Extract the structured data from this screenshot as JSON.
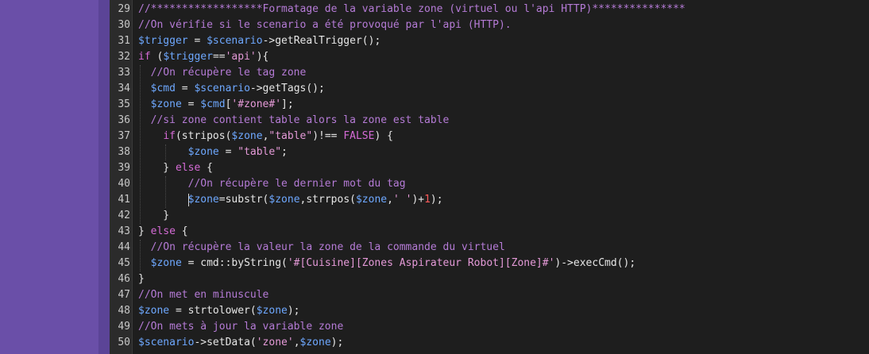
{
  "editor": {
    "lines": [
      {
        "number": "29",
        "segments": [
          {
            "t": "//******************Formatage de la variable zone (virtuel ou l'api HTTP)***************",
            "c": "c-comment"
          }
        ]
      },
      {
        "number": "30",
        "segments": [
          {
            "t": "//On vérifie si le scenario a été provoqué par l'api (HTTP).",
            "c": "c-comment"
          }
        ]
      },
      {
        "number": "31",
        "segments": [
          {
            "t": "$trigger",
            "c": "c-var"
          },
          {
            "t": " = ",
            "c": "c-op"
          },
          {
            "t": "$scenario",
            "c": "c-var"
          },
          {
            "t": "->getRealTrigger();",
            "c": "c-func"
          }
        ]
      },
      {
        "number": "32",
        "segments": [
          {
            "t": "if",
            "c": "c-kw"
          },
          {
            "t": " (",
            "c": "c-op"
          },
          {
            "t": "$trigger",
            "c": "c-var"
          },
          {
            "t": "==",
            "c": "c-op"
          },
          {
            "t": "'api'",
            "c": "c-str"
          },
          {
            "t": "){",
            "c": "c-op"
          }
        ]
      },
      {
        "number": "33",
        "segments": [
          {
            "t": "  ",
            "c": "c-op"
          },
          {
            "t": "//On récupère le tag zone",
            "c": "c-comment"
          }
        ]
      },
      {
        "number": "34",
        "segments": [
          {
            "t": "  ",
            "c": "c-op"
          },
          {
            "t": "$cmd",
            "c": "c-var"
          },
          {
            "t": " = ",
            "c": "c-op"
          },
          {
            "t": "$scenario",
            "c": "c-var"
          },
          {
            "t": "->getTags();",
            "c": "c-func"
          }
        ]
      },
      {
        "number": "35",
        "segments": [
          {
            "t": "  ",
            "c": "c-op"
          },
          {
            "t": "$zone",
            "c": "c-var"
          },
          {
            "t": " = ",
            "c": "c-op"
          },
          {
            "t": "$cmd",
            "c": "c-var"
          },
          {
            "t": "[",
            "c": "c-op"
          },
          {
            "t": "'#zone#'",
            "c": "c-str"
          },
          {
            "t": "];",
            "c": "c-op"
          }
        ]
      },
      {
        "number": "36",
        "segments": [
          {
            "t": "  ",
            "c": "c-op"
          },
          {
            "t": "//si zone contient table alors la zone est table",
            "c": "c-comment"
          }
        ]
      },
      {
        "number": "37",
        "segments": [
          {
            "t": "    ",
            "c": "c-op"
          },
          {
            "t": "if",
            "c": "c-kw"
          },
          {
            "t": "(stripos(",
            "c": "c-func"
          },
          {
            "t": "$zone",
            "c": "c-var"
          },
          {
            "t": ",",
            "c": "c-op"
          },
          {
            "t": "\"table\"",
            "c": "c-str"
          },
          {
            "t": ")!== ",
            "c": "c-op"
          },
          {
            "t": "FALSE",
            "c": "c-kw"
          },
          {
            "t": ") {",
            "c": "c-op"
          }
        ]
      },
      {
        "number": "38",
        "segments": [
          {
            "t": "        ",
            "c": "c-op"
          },
          {
            "t": "$zone",
            "c": "c-var"
          },
          {
            "t": " = ",
            "c": "c-op"
          },
          {
            "t": "\"table\"",
            "c": "c-str"
          },
          {
            "t": ";",
            "c": "c-op"
          }
        ]
      },
      {
        "number": "39",
        "segments": [
          {
            "t": "    } ",
            "c": "c-op"
          },
          {
            "t": "else",
            "c": "c-kw"
          },
          {
            "t": " {",
            "c": "c-op"
          }
        ]
      },
      {
        "number": "40",
        "segments": [
          {
            "t": "        ",
            "c": "c-op"
          },
          {
            "t": "//On récupère le dernier mot du tag",
            "c": "c-comment"
          }
        ]
      },
      {
        "number": "41",
        "cursor": true,
        "segments": [
          {
            "t": "        ",
            "c": "c-op"
          },
          {
            "t": "$zone",
            "c": "c-var"
          },
          {
            "t": "=substr(",
            "c": "c-func"
          },
          {
            "t": "$zone",
            "c": "c-var"
          },
          {
            "t": ",strrpos(",
            "c": "c-func"
          },
          {
            "t": "$zone",
            "c": "c-var"
          },
          {
            "t": ",",
            "c": "c-op"
          },
          {
            "t": "' '",
            "c": "c-str"
          },
          {
            "t": ")+",
            "c": "c-op"
          },
          {
            "t": "1",
            "c": "c-num"
          },
          {
            "t": ");",
            "c": "c-op"
          }
        ]
      },
      {
        "number": "42",
        "segments": [
          {
            "t": "    }",
            "c": "c-op"
          }
        ]
      },
      {
        "number": "43",
        "segments": [
          {
            "t": "} ",
            "c": "c-op"
          },
          {
            "t": "else",
            "c": "c-kw"
          },
          {
            "t": " {",
            "c": "c-op"
          }
        ]
      },
      {
        "number": "44",
        "segments": [
          {
            "t": "  ",
            "c": "c-op"
          },
          {
            "t": "//On récupère la valeur la zone de la commande du virtuel",
            "c": "c-comment"
          }
        ]
      },
      {
        "number": "45",
        "segments": [
          {
            "t": "  ",
            "c": "c-op"
          },
          {
            "t": "$zone",
            "c": "c-var"
          },
          {
            "t": " = cmd::byString(",
            "c": "c-func"
          },
          {
            "t": "'#[Cuisine][Zones Aspirateur Robot][Zone]#'",
            "c": "c-str"
          },
          {
            "t": ")->execCmd();",
            "c": "c-func"
          }
        ]
      },
      {
        "number": "46",
        "segments": [
          {
            "t": "}",
            "c": "c-op"
          }
        ]
      },
      {
        "number": "47",
        "segments": [
          {
            "t": "//On met en minuscule",
            "c": "c-comment"
          }
        ]
      },
      {
        "number": "48",
        "segments": [
          {
            "t": "$zone",
            "c": "c-var"
          },
          {
            "t": " = strtolower(",
            "c": "c-func"
          },
          {
            "t": "$zone",
            "c": "c-var"
          },
          {
            "t": ");",
            "c": "c-op"
          }
        ]
      },
      {
        "number": "49",
        "segments": [
          {
            "t": "//On mets à jour la variable zone",
            "c": "c-comment"
          }
        ]
      },
      {
        "number": "50",
        "segments": [
          {
            "t": "$scenario",
            "c": "c-var"
          },
          {
            "t": "->setData(",
            "c": "c-func"
          },
          {
            "t": "'zone'",
            "c": "c-str"
          },
          {
            "t": ",",
            "c": "c-op"
          },
          {
            "t": "$zone",
            "c": "c-var"
          },
          {
            "t": ");",
            "c": "c-op"
          }
        ]
      }
    ]
  }
}
